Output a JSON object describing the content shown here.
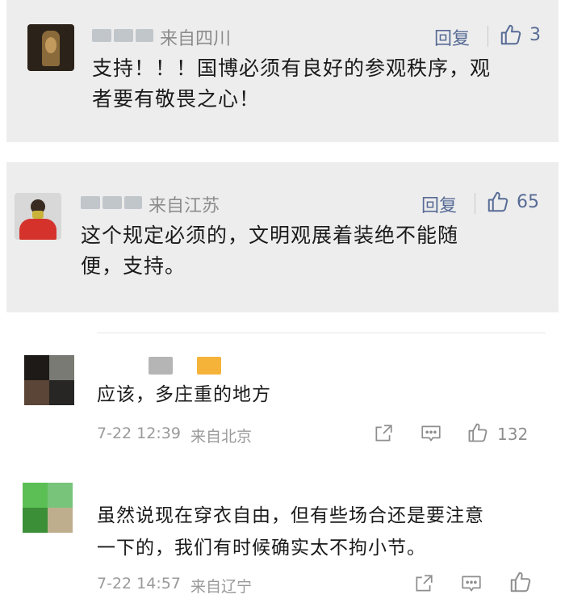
{
  "card1": {
    "location": "来自四川",
    "reply_label": "回复",
    "likes": "3",
    "text_line1": "支持！！！国博必须有良好的参观秩序，观",
    "text_line2": "者要有敬畏之心！"
  },
  "card2": {
    "location": "来自江苏",
    "reply_label": "回复",
    "likes": "65",
    "text_line1": "这个规定必须的，文明观展着装绝不能随",
    "text_line2": "便，支持。"
  },
  "comment1": {
    "text": "应该，多庄重的地方",
    "time": "7-22 12:39",
    "location": "来自北京",
    "likes": "132",
    "nick_colors": [
      "#b5b5b5",
      "#f6b33a"
    ],
    "avatar_colors": [
      "#1d1a17",
      "#7a7a74",
      "#5a4536",
      "#272624"
    ]
  },
  "comment2": {
    "text_line1": "虽然说现在穿衣自由，但有些场合还是要注意",
    "text_line2": "一下的，我们有时候确实太不拘小节。",
    "time": "7-22 14:57",
    "location": "来自辽宁",
    "avatar_colors": [
      "#5cbf55",
      "#78c47a",
      "#3b8f37",
      "#bfae8e"
    ]
  },
  "colors": {
    "card_bg": "#ededed",
    "link_blue": "#576b95",
    "meta_gray": "#9a9a9a"
  }
}
